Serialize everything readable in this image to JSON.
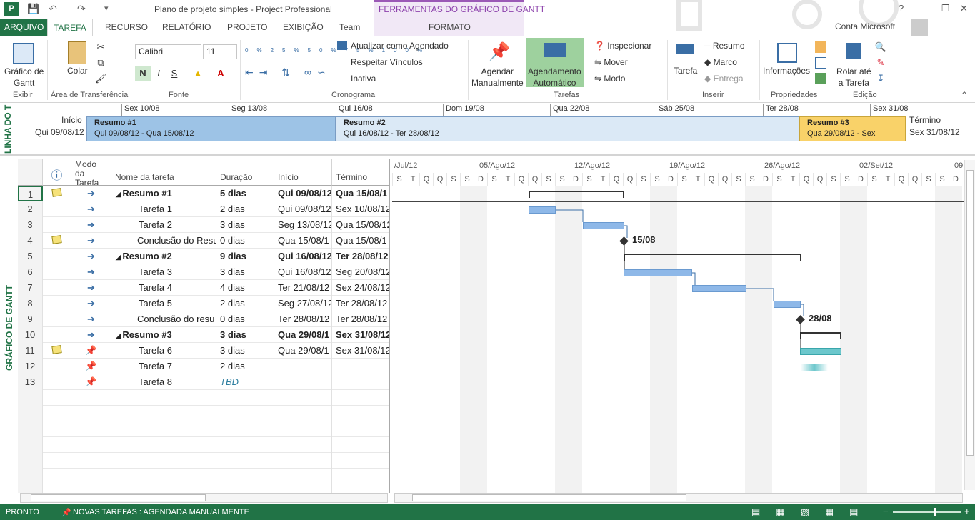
{
  "window": {
    "title": "Plano de projeto simples - Project Professional",
    "context_title": "FERRAMENTAS DO GRÁFICO DE GANTT",
    "help": "?",
    "account": "Conta Microsoft"
  },
  "tabs": [
    "ARQUIVO",
    "TAREFA",
    "RECURSO",
    "RELATÓRIO",
    "PROJETO",
    "EXIBIÇÃO",
    "Team",
    "FORMATO"
  ],
  "ribbon": {
    "groups": [
      "Exibir",
      "Área de Transferência",
      "Fonte",
      "Cronograma",
      "Tarefas",
      "Inserir",
      "Propriedades",
      "Edição"
    ],
    "gantt_btn": "Gráfico de\nGantt",
    "paste_btn": "Colar",
    "font_name": "Calibri",
    "font_size": "11",
    "bold": "N",
    "italic": "I",
    "underline": "S",
    "pct": [
      "0%",
      "25%",
      "50%",
      "75%",
      "100%"
    ],
    "update_sched": "Atualizar como Agendado",
    "respect_links": "Respeitar Vínculos",
    "inactive": "Inativa",
    "manual": "Agendar\nManualmente",
    "auto": "Agendamento\nAutomático",
    "inspect": "Inspecionar",
    "move": "Mover",
    "mode": "Modo",
    "task": "Tarefa",
    "summary": "Resumo",
    "milestone": "Marco",
    "deliverable": "Entrega",
    "info": "Informações",
    "scroll_task": "Rolar até\na Tarefa"
  },
  "timeline": {
    "side_label": "LINHA DO T",
    "start_label": "Início",
    "start_date": "Qui 09/08/12",
    "end_label": "Término",
    "end_date": "Sex 31/08/12",
    "dates": [
      "Sex 10/08",
      "Seg 13/08",
      "Qui 16/08",
      "Dom 19/08",
      "Qua 22/08",
      "Sáb 25/08",
      "Ter 28/08",
      "Sex 31/08"
    ],
    "bars": [
      {
        "title": "Resumo #1",
        "range": "Qui 09/08/12 - Qua 15/08/12"
      },
      {
        "title": "Resumo #2",
        "range": "Qui 16/08/12 - Ter 28/08/12"
      },
      {
        "title": "Resumo #3",
        "range": "Qua 29/08/12 - Sex"
      }
    ]
  },
  "gantt_side_label": "GRÁFICO DE GANTT",
  "columns": [
    "Modo da Tarefa",
    "Nome da tarefa",
    "Duração",
    "Início",
    "Término"
  ],
  "rows": [
    {
      "id": "1",
      "name": "Resumo #1",
      "dur": "5 dias",
      "start": "Qui 09/08/12",
      "end": "Qua 15/08/1",
      "summary": true,
      "note": true
    },
    {
      "id": "2",
      "name": "Tarefa 1",
      "dur": "2 dias",
      "start": "Qui 09/08/12",
      "end": "Sex 10/08/12"
    },
    {
      "id": "3",
      "name": "Tarefa 2",
      "dur": "3 dias",
      "start": "Seg 13/08/12",
      "end": "Qua 15/08/12"
    },
    {
      "id": "4",
      "name": "Conclusão do Resu",
      "dur": "0 dias",
      "start": "Qua 15/08/1",
      "end": "Qua 15/08/1",
      "note": true
    },
    {
      "id": "5",
      "name": "Resumo #2",
      "dur": "9 dias",
      "start": "Qui 16/08/12",
      "end": "Ter 28/08/12",
      "summary": true
    },
    {
      "id": "6",
      "name": "Tarefa 3",
      "dur": "3 dias",
      "start": "Qui 16/08/12",
      "end": "Seg 20/08/12"
    },
    {
      "id": "7",
      "name": "Tarefa 4",
      "dur": "4 dias",
      "start": "Ter 21/08/12",
      "end": "Sex 24/08/12"
    },
    {
      "id": "8",
      "name": "Tarefa 5",
      "dur": "2 dias",
      "start": "Seg 27/08/12",
      "end": "Ter 28/08/12"
    },
    {
      "id": "9",
      "name": "Conclusão do resu",
      "dur": "0 dias",
      "start": "Ter 28/08/12",
      "end": "Ter 28/08/12"
    },
    {
      "id": "10",
      "name": "Resumo #3",
      "dur": "3 dias",
      "start": "Qua 29/08/1",
      "end": "Sex 31/08/12",
      "summary": true
    },
    {
      "id": "11",
      "name": "Tarefa 6",
      "dur": "3 dias",
      "start": "Qua 29/08/1",
      "end": "Sex 31/08/12",
      "note": true,
      "manual": true
    },
    {
      "id": "12",
      "name": "Tarefa 7",
      "dur": "2 dias",
      "start": "",
      "end": "",
      "manual": true
    },
    {
      "id": "13",
      "name": "Tarefa 8",
      "dur": "TBD",
      "start": "",
      "end": "",
      "manual": true
    }
  ],
  "chart": {
    "weeks": [
      "/Jul/12",
      "05/Ago/12",
      "12/Ago/12",
      "19/Ago/12",
      "26/Ago/12",
      "02/Set/12",
      "09"
    ],
    "days": "STQQSSDSTQQSSDSTQQSSDSTQQSSDSTQQSSDSTQQSSD",
    "ms1": "15/08",
    "ms2": "28/08"
  },
  "status": {
    "ready": "PRONTO",
    "new_tasks": "NOVAS TAREFAS : AGENDADA MANUALMENTE"
  }
}
